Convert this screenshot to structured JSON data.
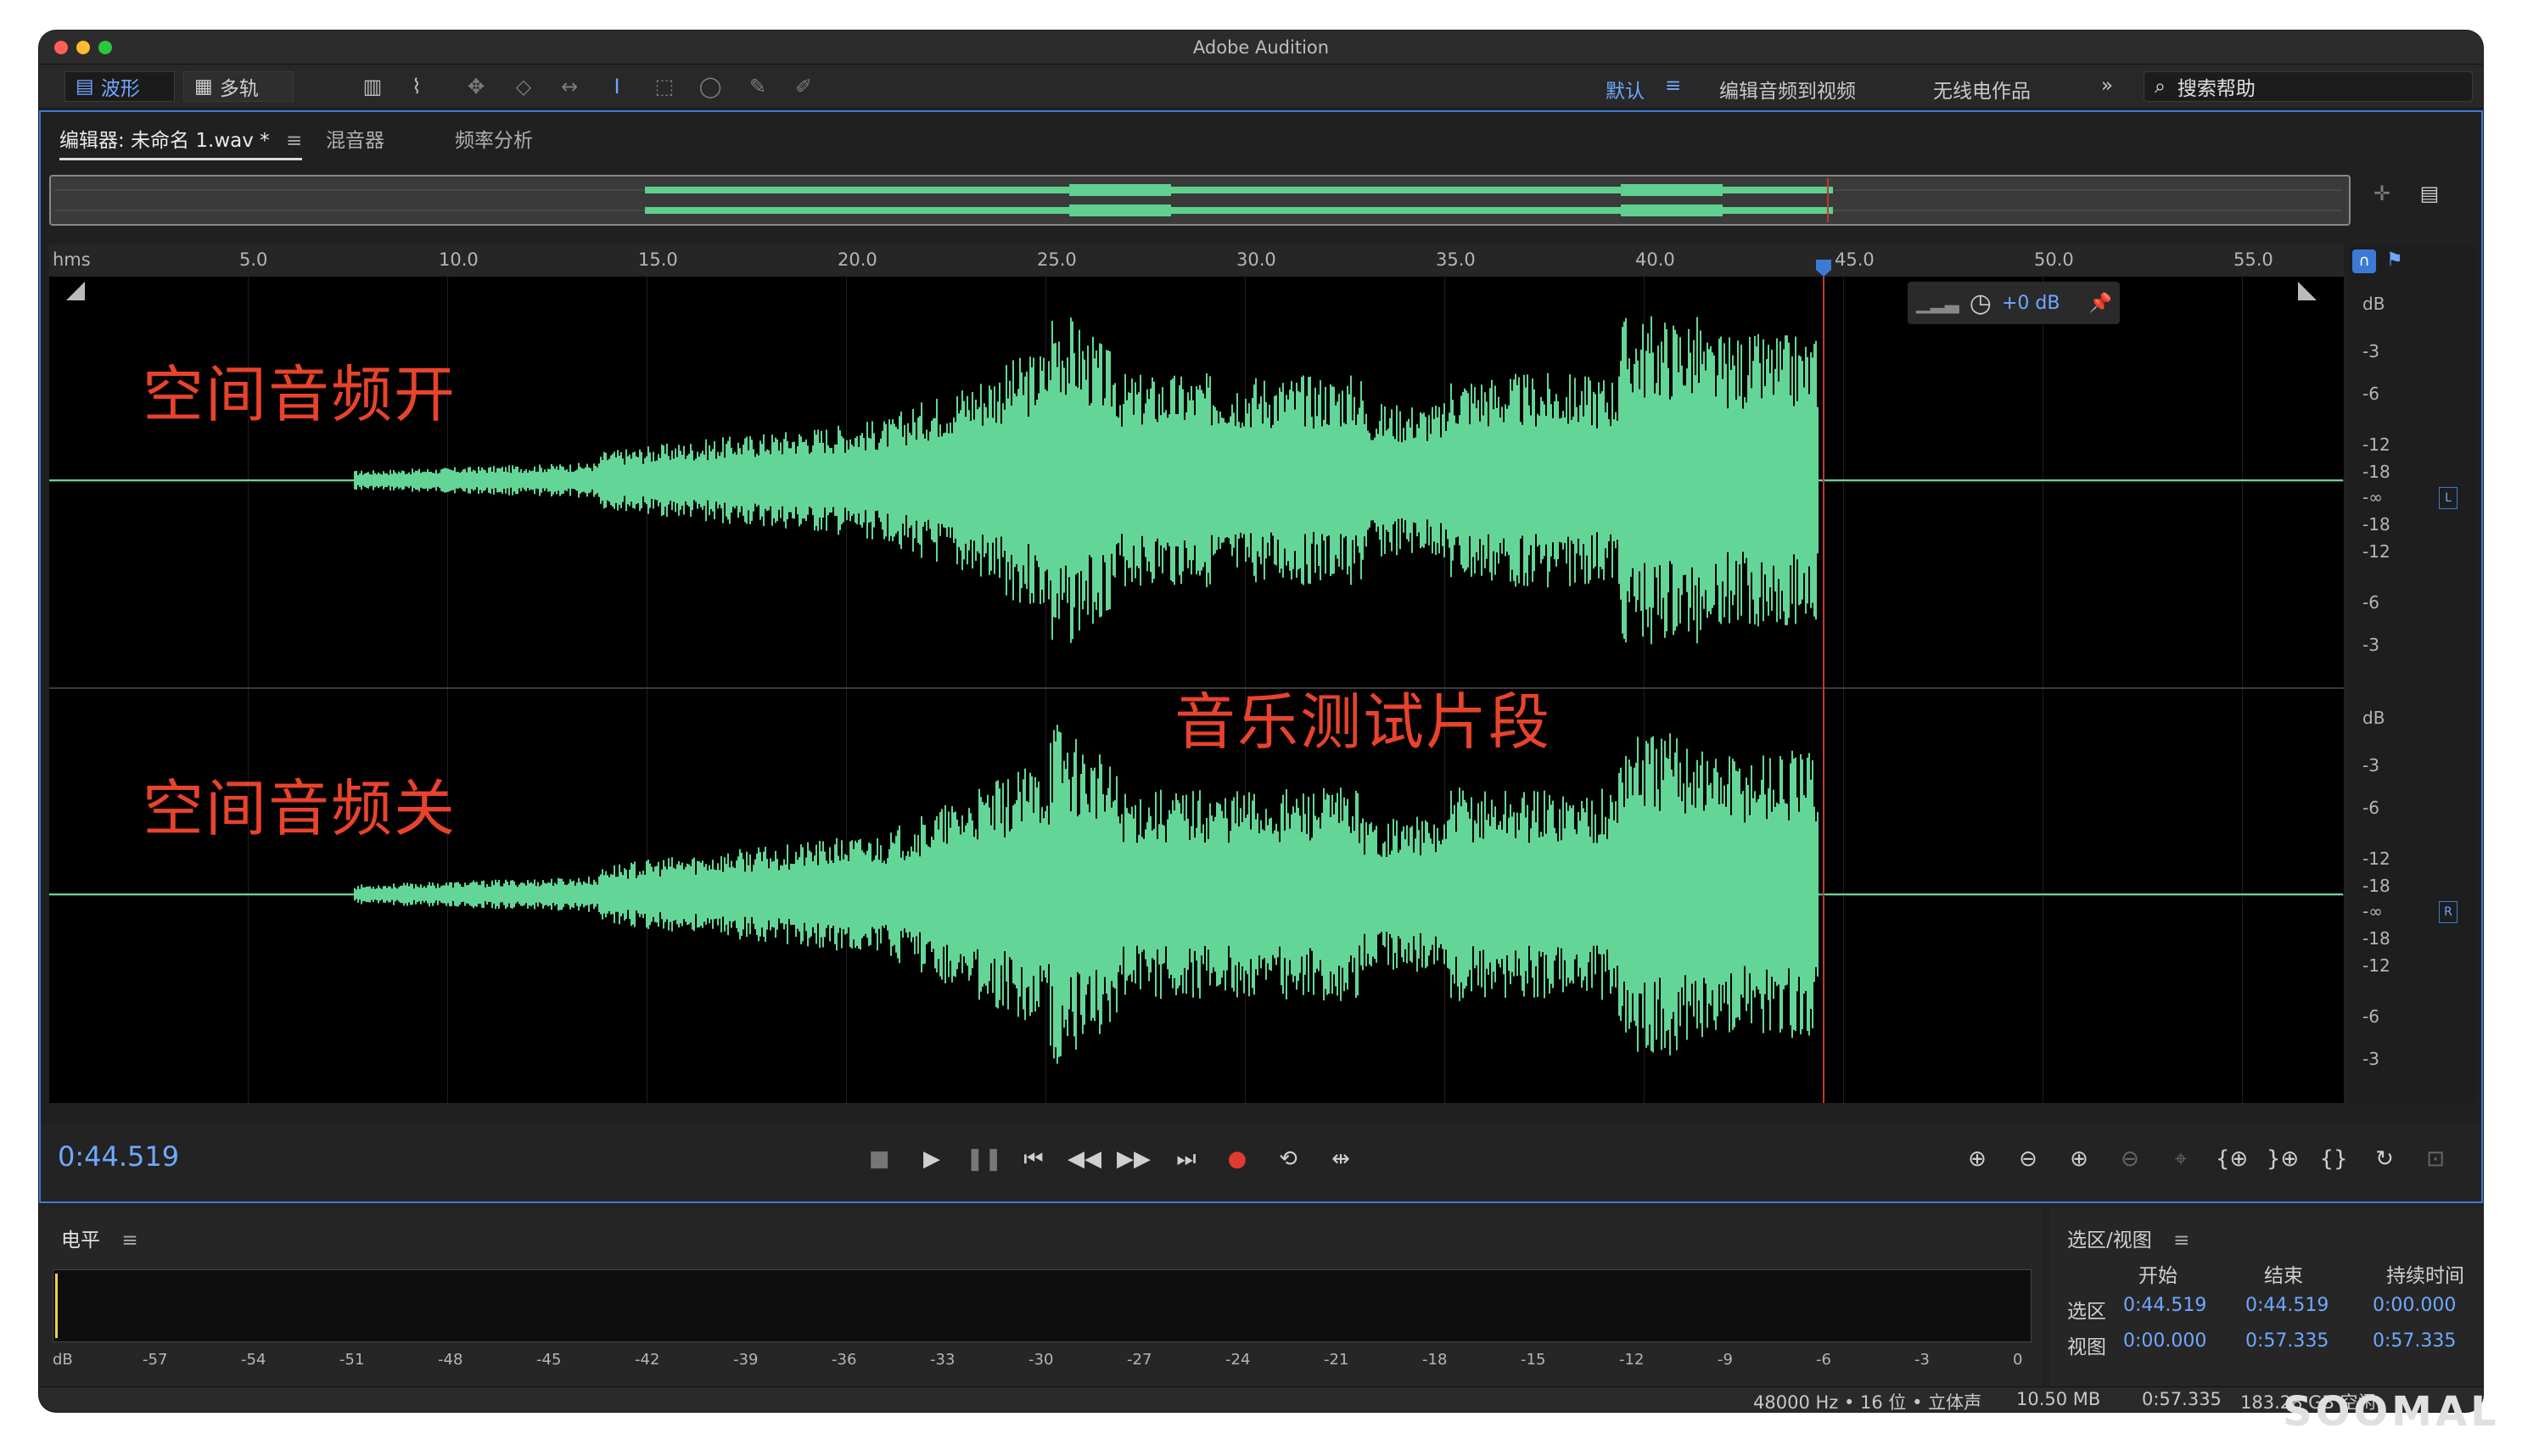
{
  "app_title": "Adobe Audition",
  "toolbar": {
    "waveform_label": "波形",
    "multitrack_label": "多轨",
    "workspaces": [
      "默认",
      "编辑音频到视频",
      "无线电作品"
    ],
    "overflow": "»",
    "search_placeholder": "搜索帮助"
  },
  "tabs": {
    "editor": "编辑器: 未命名 1.wav *",
    "mixer": "混音器",
    "frequency": "频率分析"
  },
  "ruler": {
    "unit": "hms",
    "ticks": [
      "5.0",
      "10.0",
      "15.0",
      "20.0",
      "25.0",
      "30.0",
      "35.0",
      "40.0",
      "45.0",
      "50.0",
      "55.0"
    ]
  },
  "hud": {
    "gain": "+0 dB"
  },
  "annotations": {
    "top": "空间音频开",
    "center": "音乐测试片段",
    "bottom": "空间音频关"
  },
  "db_scale": {
    "unit": "dB",
    "labels": [
      "-3",
      "-6",
      "-12",
      "-18",
      "-∞",
      "-18",
      "-12",
      "-6",
      "-3"
    ],
    "left_channel": "L",
    "right_channel": "R"
  },
  "transport": {
    "current_time": "0:44.519"
  },
  "level_panel": {
    "title": "电平",
    "scale": [
      "dB",
      "-57",
      "-54",
      "-51",
      "-48",
      "-45",
      "-42",
      "-39",
      "-36",
      "-33",
      "-30",
      "-27",
      "-24",
      "-21",
      "-18",
      "-15",
      "-12",
      "-9",
      "-6",
      "-3",
      "0"
    ]
  },
  "selection_panel": {
    "title": "选区/视图",
    "col_start": "开始",
    "col_end": "结束",
    "col_duration": "持续时间",
    "row_selection": "选区",
    "row_view": "视图",
    "selection": {
      "start": "0:44.519",
      "end": "0:44.519",
      "duration": "0:00.000"
    },
    "view": {
      "start": "0:00.000",
      "end": "0:57.335",
      "duration": "0:57.335"
    }
  },
  "status": {
    "format": "48000 Hz • 16 位 • 立体声",
    "size": "10.50 MB",
    "duration": "0:57.335",
    "free": "183.28 GB 空闲"
  },
  "watermark": "SOOMAL"
}
